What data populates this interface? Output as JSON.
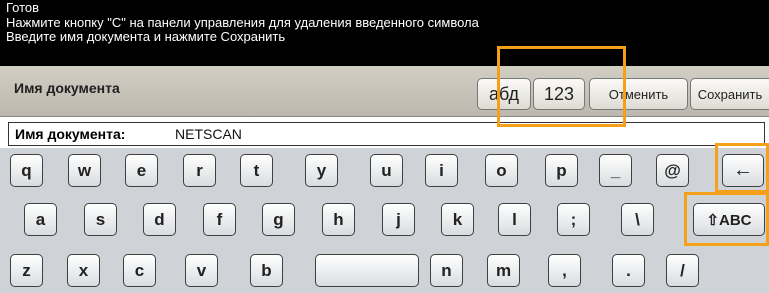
{
  "status": {
    "lines": [
      "Готов",
      "Нажмите кнопку \"С\" на панели управления для удаления введенного символа",
      "Введите имя документа и нажмите Сохранить"
    ]
  },
  "toolbar": {
    "title": "Имя документа",
    "abc_label": "абд",
    "num_label": "123",
    "cancel_label": "Отменить",
    "save_label": "Сохранить"
  },
  "field": {
    "label": "Имя документа:",
    "value": "NETSCAN"
  },
  "keyboard": {
    "row1": [
      "q",
      "w",
      "e",
      "r",
      "t",
      "y",
      "u",
      "i",
      "o",
      "p",
      "_",
      "@",
      "←"
    ],
    "row2": [
      "a",
      "s",
      "d",
      "f",
      "g",
      "h",
      "j",
      "k",
      "l",
      ";",
      "\\",
      "⇧ABC"
    ],
    "row3": [
      "z",
      "x",
      "c",
      "v",
      "b",
      "",
      "n",
      "m",
      ",",
      ".",
      "/"
    ]
  },
  "colors": {
    "highlight": "#f5a01a",
    "status_bg": "#000000",
    "keyboard_bg": "#cfd3d8"
  }
}
